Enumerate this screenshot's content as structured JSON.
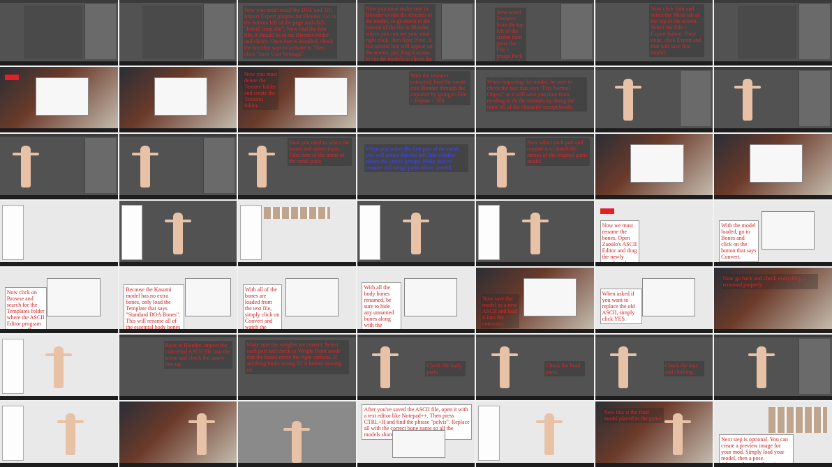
{
  "sheet_title": "ASCII model conversion tutorial (contact sheet)",
  "colors": {
    "caption_red": "#e0262b",
    "caption_blue": "#3a46ff",
    "blender_gray": "#525252",
    "windows_light": "#e9e9e9"
  },
  "captions": {
    "r1c3": "Now you need install the DOF and 3Di Import Export plugins for Blender. Go to the bottom left of the page and click \"Install from file\". Now find the first file, it should be in the Blender-folder and clickit. Once that is installed, check the box that says to activate it. Then click \"Save User Settings\".",
    "r1c4": "Now you must make sure in Blender to edit the textures of the model, so go down to the bottom of the list in Blender where you can see your mod right click, then Spec Note. A Horizontal line will appear on the screen, just drag it across to cut the models to check the images and in your textures folder.",
    "r1c5": "Now select Textures from the top left of the screen then press the File > Image Pack button and save out the images to your textures folder.",
    "r1c6": "Now click Edit and select the Mesh tab at the top of the screen. Select the File > Export button. Once done, click Export and that will save this model.",
    "r2c3": "Now you must delete the Texture folder and create the Textures folder.",
    "r2c4": "With the textures extracted, load the model into Blender through the importer by going to File > Import > 3Di",
    "r2c5": "When importing the model, be sure to check the box that says \"Flip Normal Object\" as it will save you time from needing to do the normals by doing the same all of the character except heads.",
    "r3c3": "Now you need to select the bones and delete them. Take note of the name of the mesh parts.",
    "r3c4": "When you select the first part of the mesh you will notice that the left side window shows the vertex groups. Make sure to rename and merge parts where needed.",
    "r3c5": "Now select each part and rename it to match the names of the original game model.",
    "r4c6": "Now we must rename the bones. Open Zaoulo's ASCII Editor and drag the newly saved mesh into the program.",
    "r4c7": "With the model loaded, go to Bones and click on the button that says Convert.",
    "r5c1": "Now click on Browse and search for the Templates folder where the ASCII Editor program is originally located.",
    "r5c2": "Because the Kasumi model has no extra bones, only load the Template that says \"Standard DOA Bones\". This will rename all of the essential body bones on a DOA model.",
    "r5c3": "With all of the bones are loaded from the text file, simply click on Convert and watch the magic happen.",
    "r5c4": "With all the body bones renamed, be sure to hide any unnamed bones along with the Metacarpel and Hand bones.",
    "r5c5": "Now save the model as a new ASCII and load it into the converter.",
    "r5c6": "When asked if you want to replace the old ASCII, simply click YES.",
    "r5c7": "Now go back and check everything is renamed properly.",
    "r6c2": "Back in Blender, import the converted ASCII file into the scene and check the bones line up.",
    "r6c3": "Make sure the weights are correct. Select each part and check in Weight Paint mode that the bones move the right vertices. If anything looks wrong fix it before moving on.",
    "r6c4": "Check the body parts.",
    "r6c5": "Check the head parts.",
    "r6c6": "Check the hair and clothing.",
    "r7c4": "After you've saved the ASCII file, open it with a text editor like Notepad++. Then press CTRL+H and find the phrase \"pelvis\". Replace all with the correct bone name so all the models share the same skeleton.",
    "r7c6": "Now this is the final model placed in the game.",
    "r7c7": "Next step is optional. You can create a preview image for your mod. Simply load your model, then a pose. Afterwards, go to Save image and choose your style."
  }
}
